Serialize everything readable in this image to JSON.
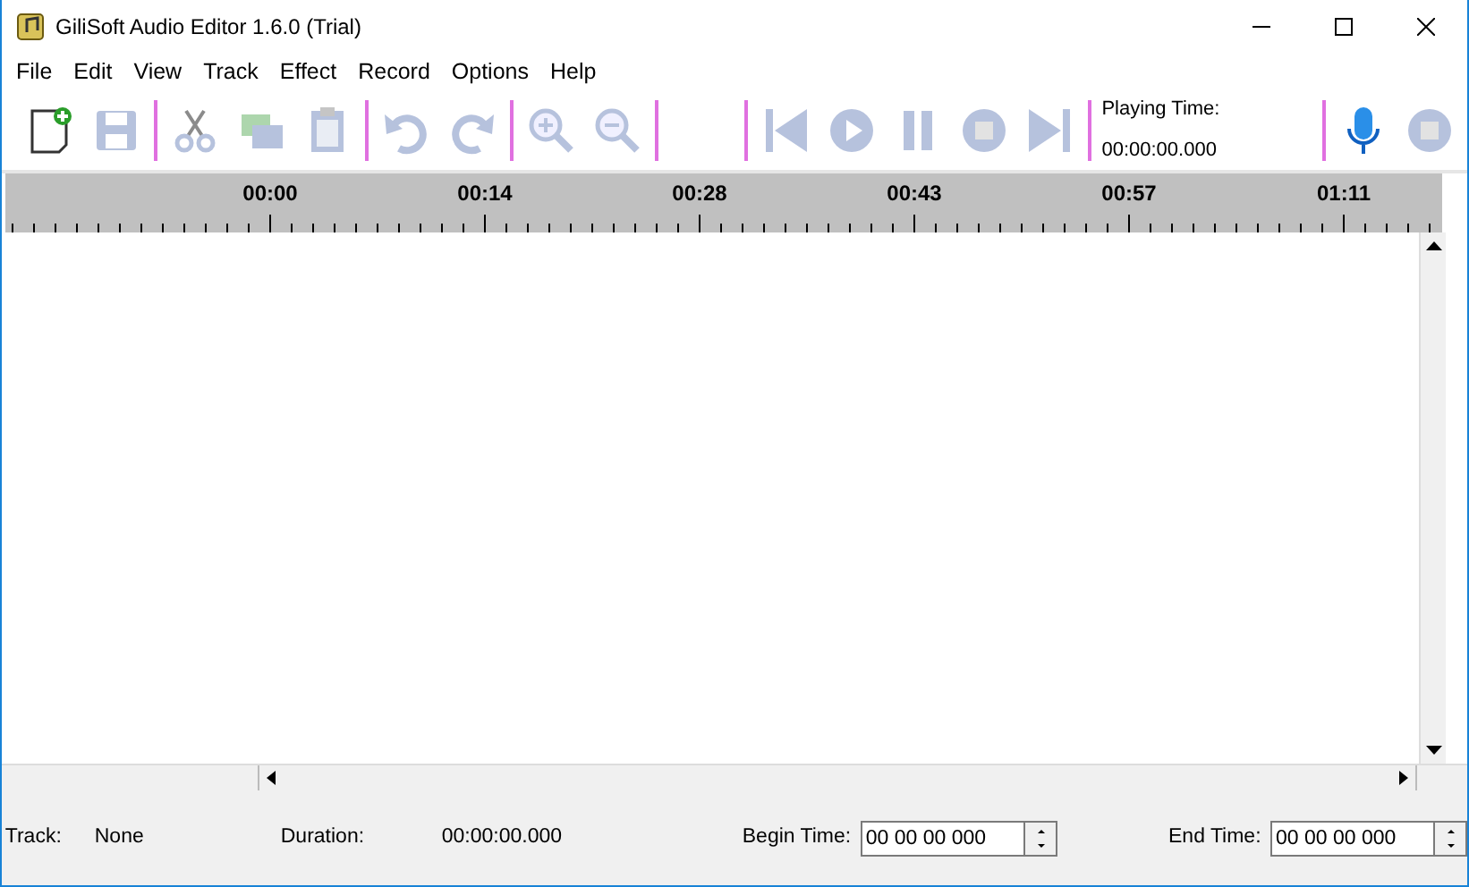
{
  "window": {
    "title": "GiliSoft Audio Editor 1.6.0 (Trial)"
  },
  "menu": [
    "File",
    "Edit",
    "View",
    "Track",
    "Effect",
    "Record",
    "Options",
    "Help"
  ],
  "toolbar": {
    "groups": [
      [
        {
          "kind": "new",
          "disabled": false
        },
        {
          "kind": "save",
          "disabled": true
        }
      ],
      [
        {
          "kind": "cut",
          "disabled": true
        },
        {
          "kind": "copy",
          "disabled": true
        },
        {
          "kind": "paste",
          "disabled": true
        }
      ],
      [
        {
          "kind": "undo",
          "disabled": true
        },
        {
          "kind": "redo",
          "disabled": true
        }
      ],
      [
        {
          "kind": "zoomin",
          "disabled": true
        },
        {
          "kind": "zoomout",
          "disabled": true
        }
      ],
      [
        {
          "kind": "previous",
          "disabled": true
        },
        {
          "kind": "play",
          "disabled": true
        },
        {
          "kind": "pause",
          "disabled": true
        },
        {
          "kind": "stop",
          "disabled": true
        },
        {
          "kind": "next",
          "disabled": true
        }
      ]
    ],
    "playing_time": {
      "label": "Playing Time:",
      "value": "00:00:00.000"
    },
    "record_buttons": [
      {
        "kind": "microphone",
        "disabled": false
      },
      {
        "kind": "record",
        "disabled": true
      }
    ]
  },
  "ruler": {
    "labels": [
      "00:00",
      "00:14",
      "00:28",
      "00:43",
      "00:57",
      "01:11"
    ]
  },
  "status": {
    "track_label": "Track:",
    "track_value": "None",
    "duration_label": "Duration:",
    "duration_value": "00:00:00.000",
    "begin_label": "Begin Time:",
    "begin_value": "00 00 00 000",
    "end_label": "End Time:",
    "end_value": "00 00 00 000"
  }
}
